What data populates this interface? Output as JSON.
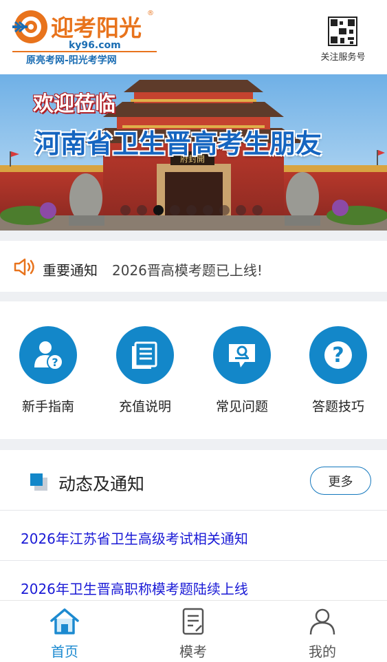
{
  "header": {
    "logo_name": "迎考阳光",
    "logo_url": "ky96.com",
    "logo_tagline": "原亮考网-阳光考学网",
    "qr_label": "关注服务号"
  },
  "banner": {
    "welcome": "欢迎莅临",
    "title": "河南省卫生晋高考生朋友",
    "slide_count": 9,
    "active_slide": 2
  },
  "notice": {
    "icon": "speaker-icon",
    "label": "重要通知",
    "text": "2026晋高模考题已上线!"
  },
  "quick_links": [
    {
      "label": "新手指南",
      "icon": "user-question-icon"
    },
    {
      "label": "充值说明",
      "icon": "document-list-icon"
    },
    {
      "label": "常见问题",
      "icon": "chat-search-icon"
    },
    {
      "label": "答题技巧",
      "icon": "question-icon"
    }
  ],
  "news": {
    "title": "动态及通知",
    "more_label": "更多",
    "items": [
      "2026年江苏省卫生高级考试相关通知",
      "2026年卫生晋高职称模考题陆续上线"
    ]
  },
  "tabbar": {
    "tabs": [
      {
        "label": "首页",
        "icon": "home-icon",
        "active": true
      },
      {
        "label": "模考",
        "icon": "exam-paper-icon",
        "active": false
      },
      {
        "label": "我的",
        "icon": "user-icon",
        "active": false
      }
    ]
  },
  "colors": {
    "accent": "#1387c9",
    "logo_orange": "#e8731c",
    "news_link": "#1a1ad6"
  }
}
